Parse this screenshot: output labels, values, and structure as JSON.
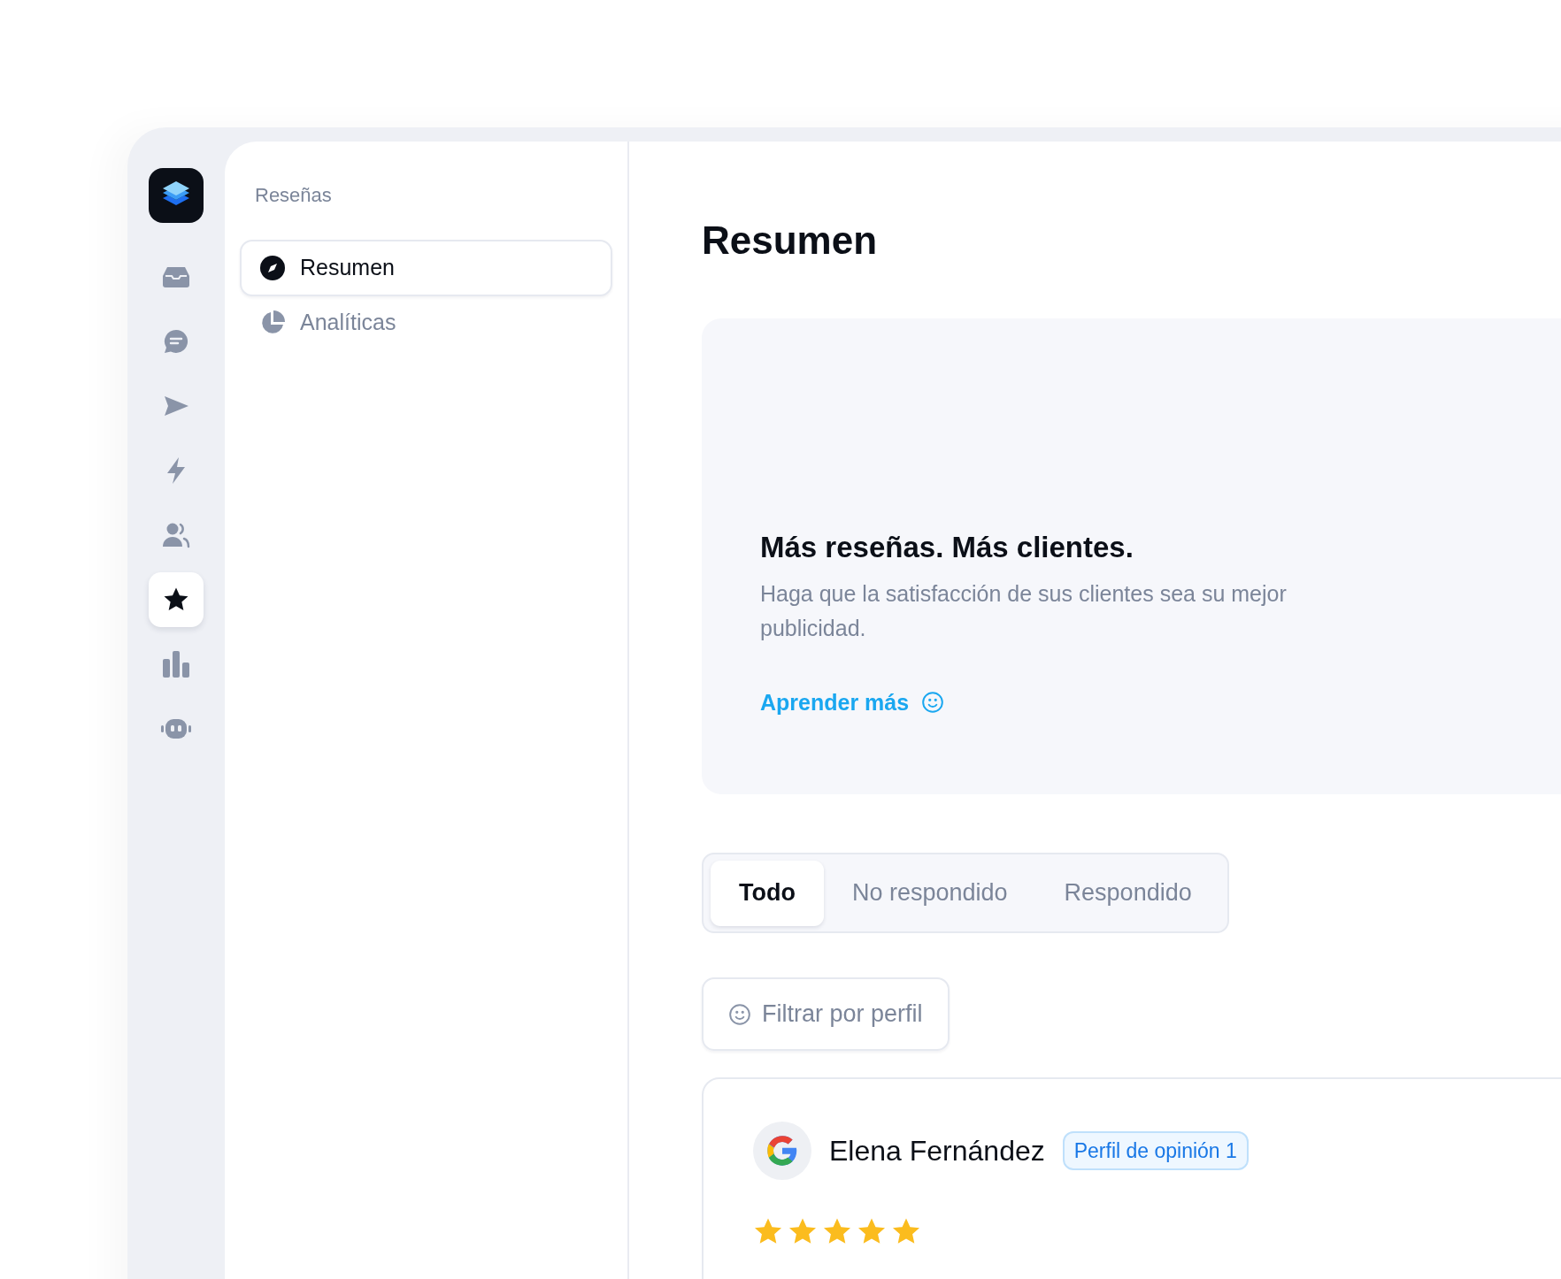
{
  "rail": {
    "items": [
      {
        "selected": false
      },
      {
        "selected": false
      },
      {
        "selected": false
      },
      {
        "selected": false
      },
      {
        "selected": false
      },
      {
        "selected": true
      },
      {
        "selected": false
      },
      {
        "selected": false
      }
    ]
  },
  "sidebar": {
    "title": "Reseñas",
    "items": [
      {
        "label": "Resumen",
        "selected": true
      },
      {
        "label": "Analíticas",
        "selected": false
      }
    ]
  },
  "main": {
    "title": "Resumen",
    "hero": {
      "headline": "Más reseñas. Más clientes.",
      "text": "Haga que la satisfacción de sus clientes sea su mejor publicidad.",
      "link": "Aprender más"
    },
    "tabs": [
      {
        "label": "Todo",
        "selected": true
      },
      {
        "label": "No respondido",
        "selected": false
      },
      {
        "label": "Respondido",
        "selected": false
      }
    ],
    "filter_button": "Filtrar por perfil",
    "review": {
      "name": "Elena Fernández",
      "badge": "Perfil de opinión 1",
      "stars": 5
    }
  }
}
